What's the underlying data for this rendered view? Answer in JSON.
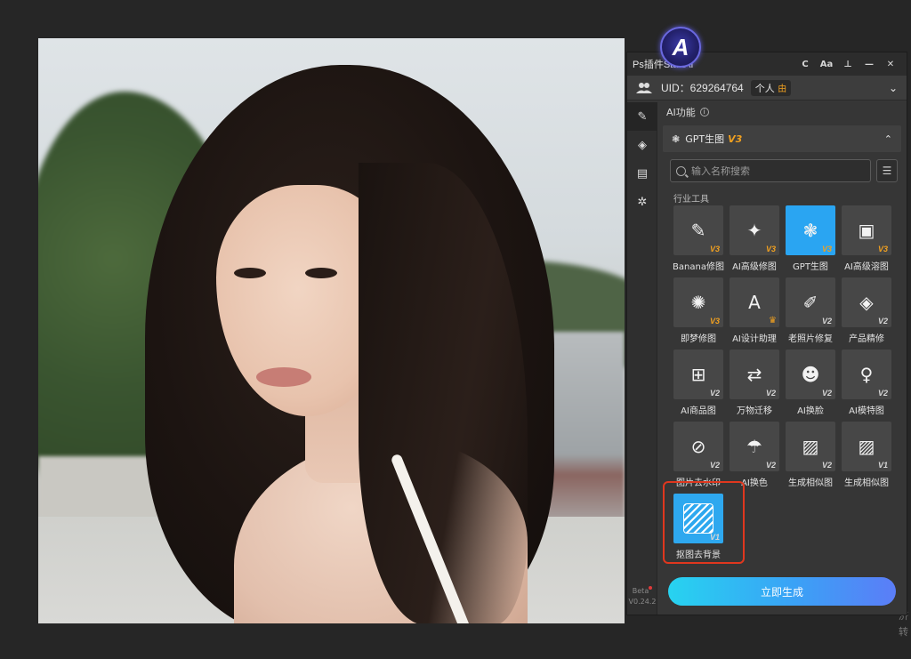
{
  "panel": {
    "title": "Ps插件StartAI",
    "logo_letter": "A",
    "titlebar_buttons": {
      "refresh": "C",
      "font": "Aa",
      "pin": "⊥",
      "minimize": "—",
      "close": "✕"
    },
    "uid_text": "UID：629264764",
    "tier": "个人",
    "tier_badge": "由",
    "section_title": "AI功能",
    "group_title": "GPT生图",
    "group_version": "V3",
    "search_placeholder": "输入名称搜索",
    "category": "行业工具",
    "generate_button": "立即生成",
    "version": {
      "beta": "Beta",
      "number": "V0.24.2"
    }
  },
  "tools": [
    {
      "label": "Banana修图",
      "version": "V3",
      "icon": "image-edit-icon",
      "glyph": "✎"
    },
    {
      "label": "AI高级修图",
      "version": "V3",
      "icon": "magic-wand-icon",
      "glyph": "✦"
    },
    {
      "label": "GPT生图",
      "version": "V3",
      "icon": "gpt-knot-icon",
      "glyph": "❃",
      "selected": true
    },
    {
      "label": "AI高级溶图",
      "version": "V3",
      "icon": "image-sparkle-icon",
      "glyph": "▣"
    },
    {
      "label": "即梦修图",
      "version": "V3",
      "icon": "planet-icon",
      "glyph": "✺"
    },
    {
      "label": "AI设计助理",
      "version": "",
      "icon": "letter-a-icon",
      "glyph": "A",
      "crown": true
    },
    {
      "label": "老照片修复",
      "version": "V2",
      "icon": "paint-bucket-icon",
      "glyph": "✐"
    },
    {
      "label": "产品精修",
      "version": "V2",
      "icon": "diamond-icon",
      "glyph": "◈"
    },
    {
      "label": "AI商品图",
      "version": "V2",
      "icon": "shopping-bag-icon",
      "glyph": "⊞"
    },
    {
      "label": "万物迁移",
      "version": "V2",
      "icon": "transfer-icon",
      "glyph": "⇄"
    },
    {
      "label": "AI换脸",
      "version": "V2",
      "icon": "face-swap-icon",
      "glyph": "☻"
    },
    {
      "label": "AI模特图",
      "version": "V2",
      "icon": "model-person-icon",
      "glyph": "♀"
    },
    {
      "label": "图片去水印",
      "version": "V2",
      "icon": "watermark-remove-icon",
      "glyph": "⊘"
    },
    {
      "label": "AI换色",
      "version": "V2",
      "icon": "tshirt-icon",
      "glyph": "☂"
    },
    {
      "label": "生成相似图",
      "version": "V2",
      "icon": "similar-image-icon",
      "glyph": "▨"
    },
    {
      "label": "生成相似图",
      "version": "V1",
      "icon": "similar-image-v1-icon",
      "glyph": "▨"
    },
    {
      "label": "抠图去背景",
      "version": "V1",
      "icon": "background-remove-icon",
      "glyph": ""
    }
  ],
  "colors": {
    "accent": "#2aa5f2",
    "version_badge": "#f0a020",
    "highlight": "#e0371e"
  },
  "edge_fragments": [
    "济",
    "转"
  ]
}
